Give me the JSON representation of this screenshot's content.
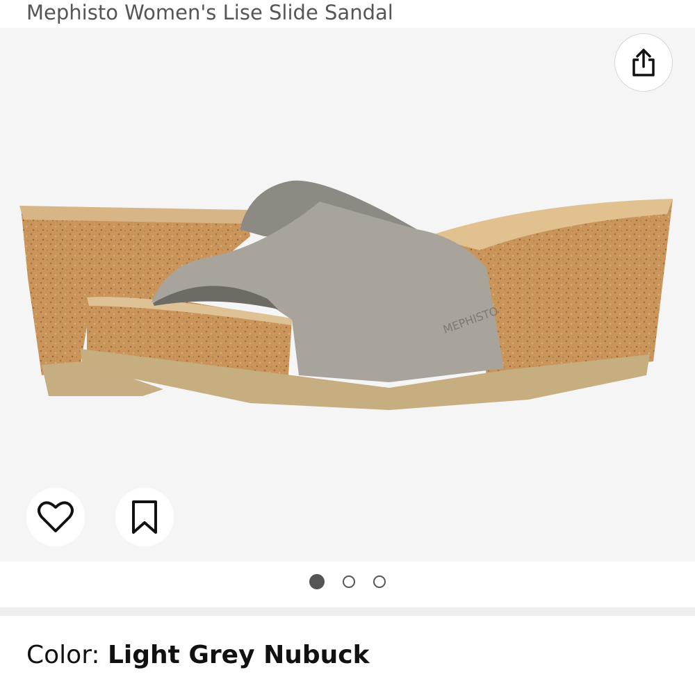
{
  "product": {
    "title": "Mephisto Women's Lise Slide Sandal",
    "image_alt": "Light grey nubuck slide sandal on cork wedge",
    "strap_logo_text": "MEPHISTO"
  },
  "gallery": {
    "icons": {
      "share": "share-icon",
      "favorite": "heart-icon",
      "save": "bookmark-icon"
    },
    "dots": [
      {
        "active": true
      },
      {
        "active": false
      },
      {
        "active": false
      }
    ]
  },
  "variant": {
    "label": "Color: ",
    "value": "Light Grey Nubuck"
  }
}
